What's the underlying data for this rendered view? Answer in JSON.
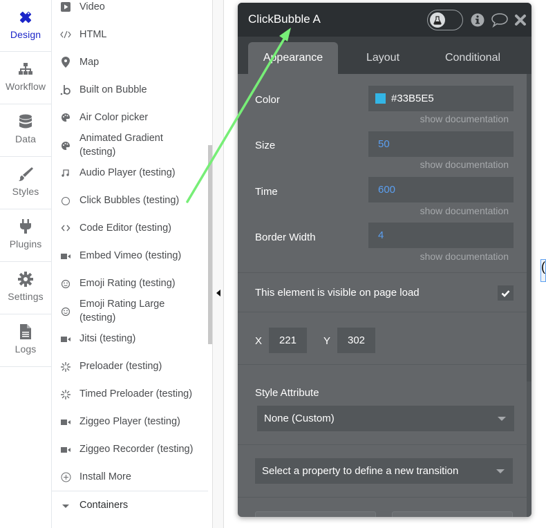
{
  "left_nav": {
    "items": [
      {
        "label": "Design",
        "icon": "design-icon",
        "active": true
      },
      {
        "label": "Workflow",
        "icon": "workflow-icon",
        "active": false
      },
      {
        "label": "Data",
        "icon": "database-icon",
        "active": false
      },
      {
        "label": "Styles",
        "icon": "brush-icon",
        "active": false
      },
      {
        "label": "Plugins",
        "icon": "plug-icon",
        "active": false
      },
      {
        "label": "Settings",
        "icon": "gear-icon",
        "active": false
      },
      {
        "label": "Logs",
        "icon": "document-icon",
        "active": false
      }
    ],
    "active_color": "#1B25C9"
  },
  "element_list": {
    "items": [
      {
        "label": "Video",
        "icon": "video-play-icon"
      },
      {
        "label": "HTML",
        "icon": "code-tag-icon"
      },
      {
        "label": "Map",
        "icon": "map-pin-icon"
      },
      {
        "label": "Built on Bubble",
        "icon": "bubble-logo-icon"
      },
      {
        "label": "Air Color picker",
        "icon": "palette-icon"
      },
      {
        "label": "Animated Gradient",
        "label2": "(testing)",
        "icon": "palette-icon"
      },
      {
        "label": "Audio Player (testing)",
        "icon": "music-note-icon"
      },
      {
        "label": "Click Bubbles (testing)",
        "icon": "circle-icon"
      },
      {
        "label": "Code Editor (testing)",
        "icon": "code-brackets-icon"
      },
      {
        "label": "Embed Vimeo (testing)",
        "icon": "video-camera-icon"
      },
      {
        "label": "Emoji Rating (testing)",
        "icon": "smiley-icon"
      },
      {
        "label": "Emoji Rating Large",
        "label2": "(testing)",
        "icon": "smiley-icon"
      },
      {
        "label": "Jitsi (testing)",
        "icon": "video-camera-icon"
      },
      {
        "label": "Preloader (testing)",
        "icon": "spinner-icon"
      },
      {
        "label": "Timed Preloader (testing)",
        "icon": "spinner-icon"
      },
      {
        "label": "Ziggeo Player (testing)",
        "icon": "video-camera-icon"
      },
      {
        "label": "Ziggeo Recorder (testing)",
        "icon": "video-camera-icon"
      },
      {
        "label": "Install More",
        "icon": "plus-circle-icon"
      }
    ],
    "section": {
      "label": "Containers",
      "icon": "caret-down-icon"
    }
  },
  "panel": {
    "title": "ClickBubble A",
    "tabs": [
      {
        "label": "Appearance",
        "active": true
      },
      {
        "label": "Layout",
        "active": false
      },
      {
        "label": "Conditional",
        "active": false
      }
    ],
    "fields": [
      {
        "label": "Color",
        "value": "#33B5E5",
        "swatch": "#33B5E5",
        "doc": "show documentation"
      },
      {
        "label": "Size",
        "value": "50",
        "doc": "show documentation"
      },
      {
        "label": "Time",
        "value": "600",
        "doc": "show documentation"
      },
      {
        "label": "Border Width",
        "value": "4",
        "doc": "show documentation"
      }
    ],
    "visible_on_load": {
      "label": "This element is visible on page load",
      "checked": true
    },
    "coords": {
      "x_label": "X",
      "x": "221",
      "y_label": "Y",
      "y": "302"
    },
    "style_attribute": {
      "label": "Style Attribute",
      "value": "None (Custom)"
    },
    "transition": {
      "placeholder": "Select a property to define a new transition"
    }
  },
  "annotation": {
    "arrow_color": "#77EE77"
  }
}
